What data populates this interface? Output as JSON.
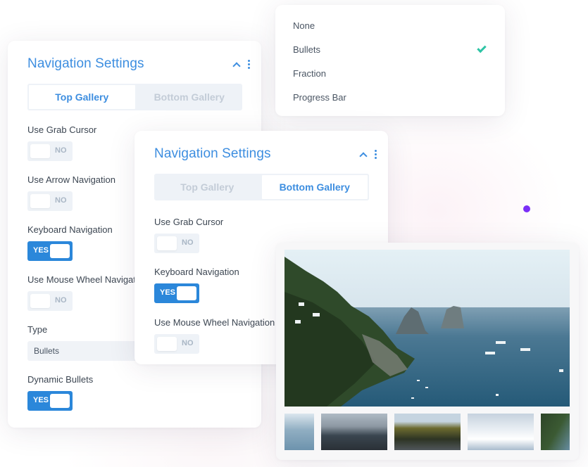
{
  "panel_top": {
    "title": "Navigation Settings",
    "tabs": [
      {
        "label": "Top Gallery",
        "active": true
      },
      {
        "label": "Bottom Gallery",
        "active": false
      }
    ],
    "fields": [
      {
        "label": "Use Grab Cursor",
        "kind": "toggle",
        "value": "NO"
      },
      {
        "label": "Use Arrow Navigation",
        "kind": "toggle",
        "value": "NO"
      },
      {
        "label": "Keyboard Navigation",
        "kind": "toggle",
        "value": "YES"
      },
      {
        "label": "Use Mouse Wheel Navigation",
        "kind": "toggle",
        "value": "NO"
      },
      {
        "label": "Type",
        "kind": "select",
        "value": "Bullets"
      },
      {
        "label": "Dynamic Bullets",
        "kind": "toggle",
        "value": "YES"
      }
    ]
  },
  "panel_bottom": {
    "title": "Navigation Settings",
    "tabs": [
      {
        "label": "Top Gallery",
        "active": false
      },
      {
        "label": "Bottom Gallery",
        "active": true
      }
    ],
    "fields": [
      {
        "label": "Use Grab Cursor",
        "kind": "toggle",
        "value": "NO"
      },
      {
        "label": "Keyboard Navigation",
        "kind": "toggle",
        "value": "YES"
      },
      {
        "label": "Use Mouse Wheel Navigation",
        "kind": "toggle",
        "value": "NO"
      }
    ]
  },
  "type_dropdown": {
    "options": [
      "None",
      "Bullets",
      "Fraction",
      "Progress Bar"
    ],
    "selected": "Bullets"
  },
  "gallery": {
    "main_image": "coastal cliffs and sea stacks with boats",
    "thumbnails": [
      "sea stack seascape",
      "mountain lodge at dusk",
      "person by forest",
      "ski chairlift over snowy peaks",
      "coastal cliffs"
    ]
  },
  "colors": {
    "accent": "#3d8ee0",
    "toggle_on": "#2b87da",
    "check": "#2ec4a5",
    "dot": "#7b2ff7"
  }
}
